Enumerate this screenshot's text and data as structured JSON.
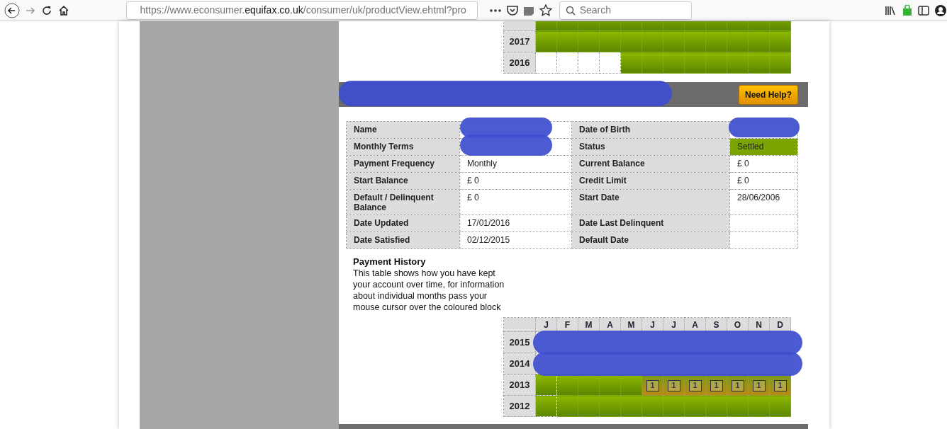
{
  "browser": {
    "url_start": "https://www.econsumer.",
    "url_domain": "equifax.co.uk",
    "url_end": "/consumer/uk/productView.ehtml?pro",
    "search_placeholder": "Search"
  },
  "top_history": {
    "rows": [
      {
        "cells": [
          {
            "kind": "ok"
          },
          {
            "kind": "ok"
          },
          {
            "kind": "ok"
          },
          {
            "kind": "ok"
          },
          {
            "kind": "ok"
          },
          {
            "kind": "ok"
          },
          {
            "kind": "ok"
          },
          {
            "kind": "ok"
          },
          {
            "kind": "ok"
          },
          {
            "kind": "ok"
          },
          {
            "kind": "ok"
          },
          {
            "kind": "ok"
          }
        ]
      },
      {
        "year": "2017",
        "cells": [
          {
            "kind": "ok"
          },
          {
            "kind": "ok"
          },
          {
            "kind": "ok"
          },
          {
            "kind": "ok"
          },
          {
            "kind": "ok"
          },
          {
            "kind": "ok"
          },
          {
            "kind": "ok"
          },
          {
            "kind": "ok"
          },
          {
            "kind": "ok"
          },
          {
            "kind": "ok"
          },
          {
            "kind": "ok"
          },
          {
            "kind": "ok"
          }
        ]
      },
      {
        "year": "2016",
        "cells": [
          {
            "kind": "empty"
          },
          {
            "kind": "empty"
          },
          {
            "kind": "empty"
          },
          {
            "kind": "empty"
          },
          {
            "kind": "ok"
          },
          {
            "kind": "ok"
          },
          {
            "kind": "ok"
          },
          {
            "kind": "ok"
          },
          {
            "kind": "ok"
          },
          {
            "kind": "ok"
          },
          {
            "kind": "ok"
          },
          {
            "kind": "ok"
          }
        ]
      }
    ]
  },
  "account": {
    "header": {
      "redacted": true,
      "help_button": "Need Help?"
    },
    "details": [
      [
        {
          "label": "Name",
          "redacted": true
        },
        {
          "label": "Date of Birth",
          "redacted": true
        }
      ],
      [
        {
          "label": "Monthly Terms",
          "redacted": true
        },
        {
          "label": "Status",
          "value": "Settled",
          "highlight": true
        }
      ],
      [
        {
          "label": "Payment Frequency",
          "value": "Monthly"
        },
        {
          "label": "Current Balance",
          "value": "£ 0"
        }
      ],
      [
        {
          "label": "Start Balance",
          "value": "£ 0"
        },
        {
          "label": "Credit Limit",
          "value": "£ 0"
        }
      ],
      [
        {
          "label": "Default / Delinquent Balance",
          "value": "£ 0"
        },
        {
          "label": "Start Date",
          "value": "28/06/2006"
        }
      ],
      [
        {
          "label": "Date Updated",
          "value": "17/01/2016"
        },
        {
          "label": "Date Last Delinquent"
        }
      ],
      [
        {
          "label": "Date Satisfied",
          "value": "02/12/2015"
        },
        {
          "label": "Default Date"
        }
      ]
    ],
    "payment_history": {
      "title": "Payment History",
      "description": "This table shows how you have kept your account over time, for information about individual months pass your mouse cursor over the coloured block",
      "months": [
        "J",
        "F",
        "M",
        "A",
        "M",
        "J",
        "J",
        "A",
        "S",
        "O",
        "N",
        "D"
      ],
      "rows": [
        {
          "year": "2015",
          "redacted": true
        },
        {
          "year": "2014",
          "redacted": true
        },
        {
          "year": "2013",
          "cells": [
            {
              "kind": "ok"
            },
            {
              "kind": "ok"
            },
            {
              "kind": "ok"
            },
            {
              "kind": "ok"
            },
            {
              "kind": "ok"
            },
            {
              "kind": "late",
              "text": "1"
            },
            {
              "kind": "late",
              "text": "1"
            },
            {
              "kind": "late",
              "text": "1"
            },
            {
              "kind": "late",
              "text": "1"
            },
            {
              "kind": "late",
              "text": "1"
            },
            {
              "kind": "late",
              "text": "1"
            },
            {
              "kind": "late",
              "text": "1"
            }
          ]
        },
        {
          "year": "2012",
          "cells": [
            {
              "kind": "ok"
            },
            {
              "kind": "ok"
            },
            {
              "kind": "ok"
            },
            {
              "kind": "ok"
            },
            {
              "kind": "ok"
            },
            {
              "kind": "ok"
            },
            {
              "kind": "ok"
            },
            {
              "kind": "ok"
            },
            {
              "kind": "ok"
            },
            {
              "kind": "ok"
            },
            {
              "kind": "ok"
            },
            {
              "kind": "ok"
            }
          ]
        }
      ]
    }
  }
}
